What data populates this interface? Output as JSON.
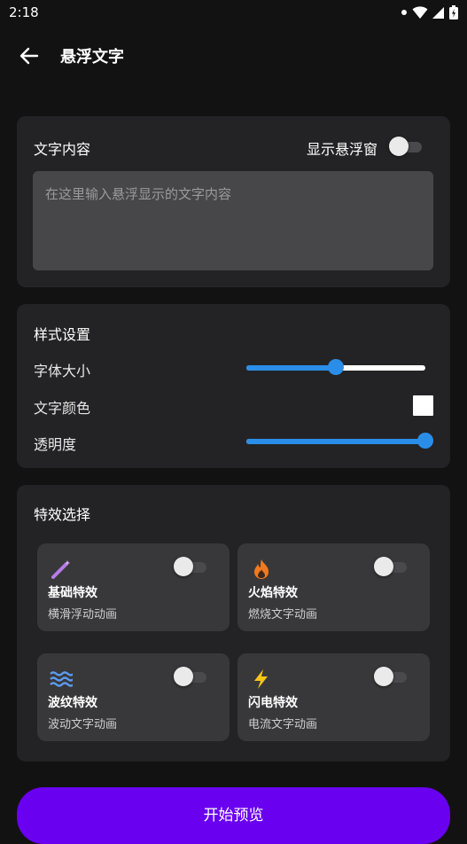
{
  "status_bar": {
    "time": "2:18"
  },
  "app_bar": {
    "title": "悬浮文字"
  },
  "text_section": {
    "title": "文字内容",
    "float_toggle_label": "显示悬浮窗",
    "float_toggle_on": false,
    "input_placeholder": "在这里输入悬浮显示的文字内容",
    "input_value": ""
  },
  "style_section": {
    "title": "样式设置",
    "font_size_label": "字体大小",
    "font_size_fraction": 0.5,
    "color_label": "文字颜色",
    "color_value": "#ffffff",
    "opacity_label": "透明度",
    "opacity_fraction": 1.0
  },
  "effects_section": {
    "title": "特效选择",
    "items": [
      {
        "name": "基础特效",
        "desc": "横滑浮动动画",
        "icon": "magic-wand-icon",
        "enabled": false
      },
      {
        "name": "火焰特效",
        "desc": "燃烧文字动画",
        "icon": "fire-icon",
        "enabled": false
      },
      {
        "name": "波纹特效",
        "desc": "波动文字动画",
        "icon": "waves-icon",
        "enabled": false
      },
      {
        "name": "闪电特效",
        "desc": "电流文字动画",
        "icon": "lightning-icon",
        "enabled": false
      }
    ]
  },
  "start_button": {
    "label": "开始预览"
  },
  "colors": {
    "accent": "#2a8ee8",
    "primary_button": "#6a00f0",
    "card_bg": "#232325",
    "effect_card_bg": "#38383a"
  }
}
